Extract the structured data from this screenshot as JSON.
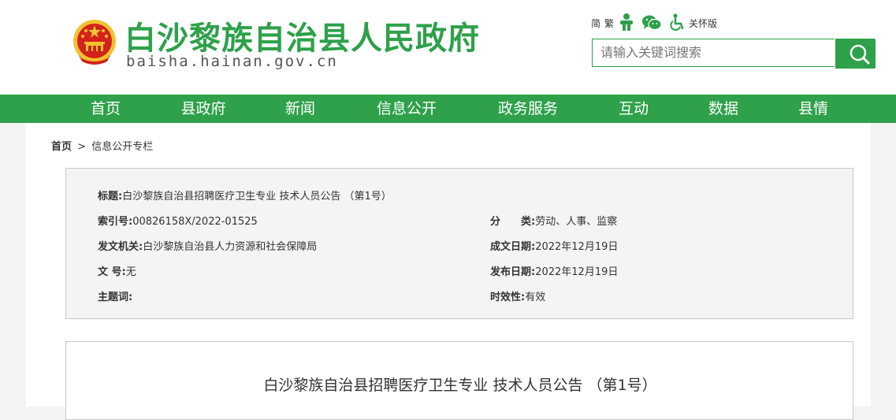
{
  "header": {
    "site_title": "白沙黎族自治县人民政府",
    "domain": "baisha.hainan.gov.cn",
    "emblem_icon": "national-emblem-icon",
    "tools": {
      "simplified": "简",
      "traditional": "繁",
      "elderly_mode": "关怀版",
      "icons": [
        "accessibility-person-icon",
        "wechat-icon",
        "wheelchair-icon"
      ]
    },
    "search": {
      "placeholder": "请输入关键词搜索",
      "button_icon": "search-icon"
    }
  },
  "nav": {
    "items": [
      "首页",
      "县政府",
      "新闻",
      "信息公开",
      "政务服务",
      "互动",
      "数据",
      "县情"
    ]
  },
  "breadcrumb": {
    "home": "首页",
    "separator": ">",
    "current": "信息公开专栏"
  },
  "meta": {
    "title_label": "标题:",
    "title_value": "白沙黎族自治县招聘医疗卫生专业 技术人员公告 （第1号）",
    "index_label": "索引号:",
    "index_value": "00826158X/2022-01525",
    "category_label": "分　　类:",
    "category_value": "劳动、人事、监察",
    "issuer_label": "发文机关:",
    "issuer_value": "白沙黎族自治县人力资源和社会保障局",
    "written_date_label": "成文日期:",
    "written_date_value": "2022年12月19日",
    "doc_no_label": "文 号:",
    "doc_no_value": "无",
    "publish_date_label": "发布日期:",
    "publish_date_value": "2022年12月19日",
    "subject_label": "主题词:",
    "subject_value": "",
    "validity_label": "时效性:",
    "validity_value": "有效"
  },
  "article": {
    "title": "白沙黎族自治县招聘医疗卫生专业 技术人员公告 （第1号）"
  },
  "colors": {
    "brand_green": "#2ea14a",
    "page_bg": "#f3f3f3",
    "meta_bg": "#f4f4f4",
    "border": "#c8c8c8",
    "emblem_red": "#d3221b",
    "emblem_gold": "#f2c230"
  }
}
